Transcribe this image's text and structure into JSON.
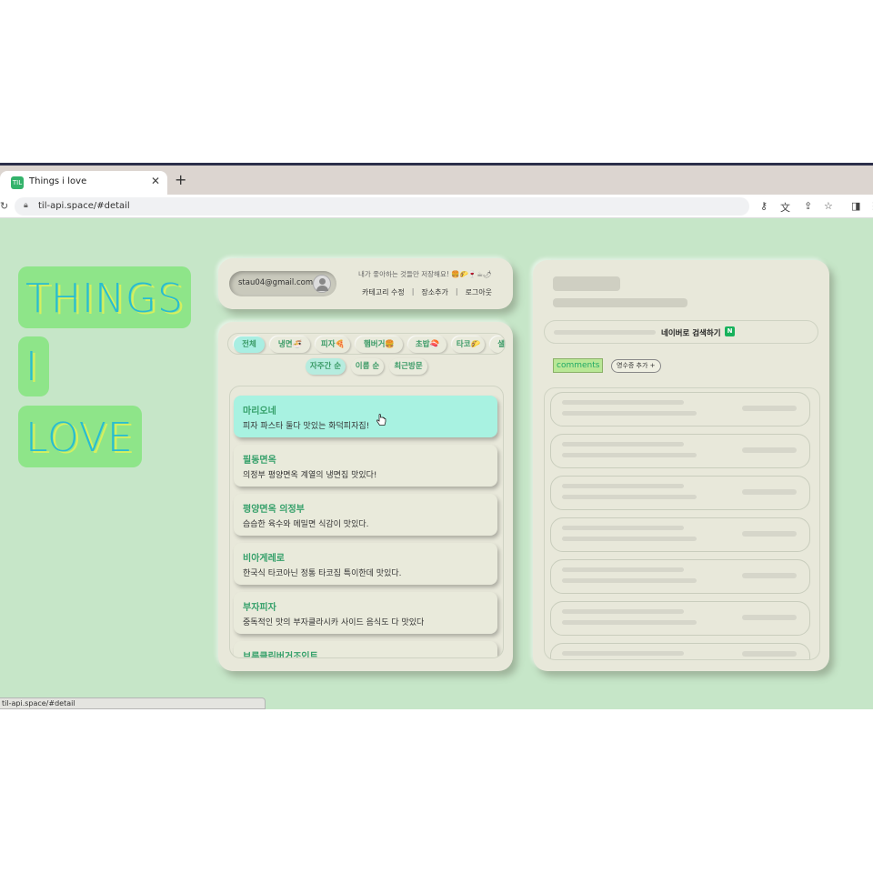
{
  "browser": {
    "tab_title": "Things i love",
    "favicon_text": "TIL",
    "tab_close": "✕",
    "new_tab": "+",
    "url": "til-api.space/#detail",
    "status_url": "til-api.space/#detail"
  },
  "hero": {
    "line1": "THINGS",
    "line2": "I",
    "line3": "LOVE"
  },
  "header": {
    "email": "stau04@gmail.com",
    "tagline": "내가 좋아하는 것들만 저장해요! 🍔🌮🍷☕🌶",
    "links": {
      "edit_category": "카테고리 수정",
      "add_place": "장소추가",
      "logout": "로그아웃",
      "sep": "|"
    }
  },
  "categories": [
    {
      "label": "전체",
      "active": true
    },
    {
      "label": "냉면🍜",
      "active": false
    },
    {
      "label": "피자🍕",
      "active": false
    },
    {
      "label": "햄버거🍔",
      "active": false
    },
    {
      "label": "초밥🍣",
      "active": false
    },
    {
      "label": "타코🌮",
      "active": false
    },
    {
      "label": "샐러드",
      "active": false
    }
  ],
  "sort": [
    {
      "label": "자주간 순",
      "active": true
    },
    {
      "label": "이름 순",
      "active": false
    },
    {
      "label": "최근방문",
      "active": false
    }
  ],
  "places": [
    {
      "name": "마리오네",
      "desc": "피자 파스타 둘다 맛있는 화덕피자집!",
      "hover": true
    },
    {
      "name": "필동면옥",
      "desc": "의정부 평양면옥 계열의 냉면집 맛있다!",
      "hover": false
    },
    {
      "name": "평양면옥 의정부",
      "desc": "슴슴한 육수와 메밀면 식감이 맛있다.",
      "hover": false
    },
    {
      "name": "비아게레로",
      "desc": "한국식 타코아닌 정통 타코집 특이한데 맛있다.",
      "hover": false
    },
    {
      "name": "부자피자",
      "desc": "중독적인 맛의 부자클라시카 사이드 음식도 다 맛있다",
      "hover": false
    },
    {
      "name": "브루클린버거조인트",
      "desc": "",
      "hover": false
    }
  ],
  "detail": {
    "naver_search": "네이버로 검색하기",
    "naver_icon": "N",
    "comments_label": "comments",
    "add_receipt": "영수증 추가 +"
  },
  "icons": {
    "reload": "reload-icon",
    "lock": "lock-icon",
    "key": "key-icon",
    "translate": "translate-icon",
    "share": "share-icon",
    "bookmark": "star-icon",
    "sidepanel": "side-panel-icon",
    "more": "more-icon"
  },
  "colors": {
    "page_bg": "#c6e6c8",
    "card_bg": "#e8e8da",
    "accent_teal": "#a8f2e1",
    "title_green": "#8ee589",
    "title_text": "#29bcd0",
    "item_name": "#35a06a"
  }
}
